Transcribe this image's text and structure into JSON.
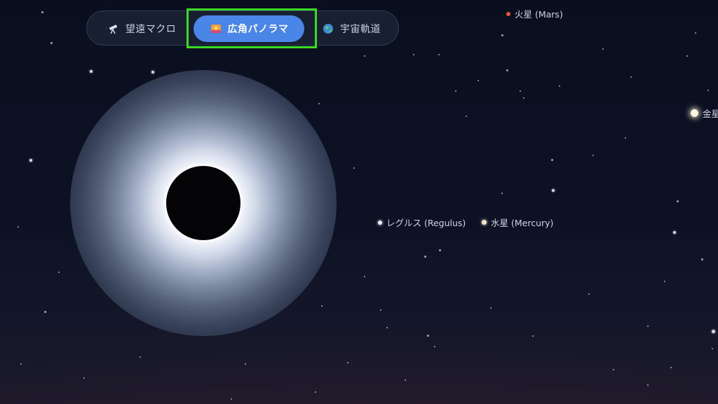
{
  "mode_switcher": {
    "items": [
      {
        "label": "望遠マクロ",
        "icon": "telescope-icon",
        "active": false
      },
      {
        "label": "広角パノラマ",
        "icon": "panorama-icon",
        "active": true
      },
      {
        "label": "宇宙軌道",
        "icon": "globe-icon",
        "active": false
      }
    ],
    "active_color": "#4a86e8",
    "highlight_color": "#3bdc28"
  },
  "bodies": {
    "mars": {
      "label": "火星 (Mars)",
      "color": "#e2583a"
    },
    "regulus": {
      "label": "レグルス (Regulus)",
      "color": "#e6eefc"
    },
    "mercury": {
      "label": "水星 (Mercury)",
      "color": "#f3e3c4"
    },
    "venus": {
      "label": "金星",
      "color": "#fff6e2"
    }
  },
  "eclipse": {
    "type": "total solar eclipse",
    "corona_color": "#ffffff"
  }
}
